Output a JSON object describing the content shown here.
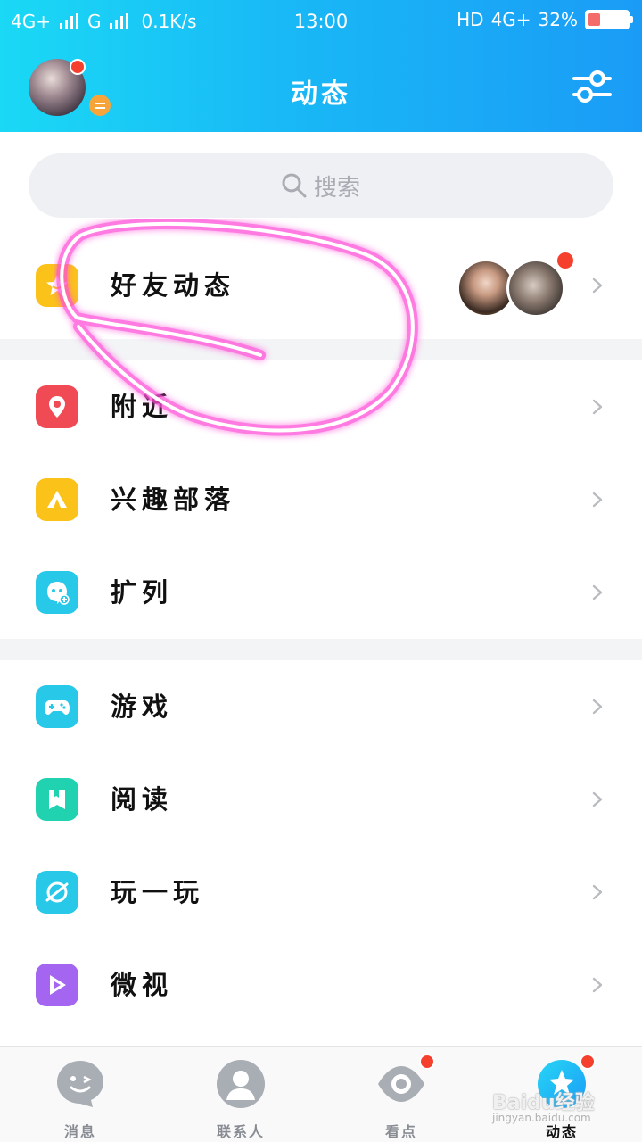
{
  "status_bar": {
    "network_left": "4G+",
    "network_mid": "G",
    "speed": "0.1K/s",
    "time": "13:00",
    "hd": "HD",
    "network_right": "4G+",
    "battery": "32%",
    "battery_level": 0.32
  },
  "header": {
    "title": "动态"
  },
  "search": {
    "placeholder": "搜索"
  },
  "sections": [
    {
      "items": [
        {
          "label": "好友动态",
          "icon": "star-feed-icon",
          "color": "#fbc21a"
        }
      ]
    },
    {
      "items": [
        {
          "label": "附近",
          "icon": "location-pin-icon",
          "color": "#f04a55"
        },
        {
          "label": "兴趣部落",
          "icon": "tent-icon",
          "color": "#fbc21a"
        },
        {
          "label": "扩列",
          "icon": "add-friend-face-icon",
          "color": "#27c8e8"
        }
      ]
    },
    {
      "items": [
        {
          "label": "游戏",
          "icon": "gamepad-icon",
          "color": "#27c8e8"
        },
        {
          "label": "阅读",
          "icon": "book-icon",
          "color": "#20d2b0"
        },
        {
          "label": "玩一玩",
          "icon": "planet-icon",
          "color": "#27c8e8"
        },
        {
          "label": "微视",
          "icon": "play-video-icon",
          "color": "#a466f0"
        }
      ]
    }
  ],
  "tabbar": {
    "tabs": [
      {
        "label": "消息",
        "icon": "message-bubble-icon",
        "badge": false,
        "active": false
      },
      {
        "label": "联系人",
        "icon": "contact-person-icon",
        "badge": false,
        "active": false
      },
      {
        "label": "看点",
        "icon": "eye-icon",
        "badge": true,
        "active": false
      },
      {
        "label": "动态",
        "icon": "star-globe-icon",
        "badge": true,
        "active": true
      }
    ]
  },
  "watermark": {
    "text": "Baidu经验",
    "sub": "jingyan.baidu.com"
  },
  "colors": {
    "header_start": "#1ad9f5",
    "header_end": "#1a9cf6",
    "badge_red": "#f5402e",
    "scribble": "#ff4fd8"
  }
}
